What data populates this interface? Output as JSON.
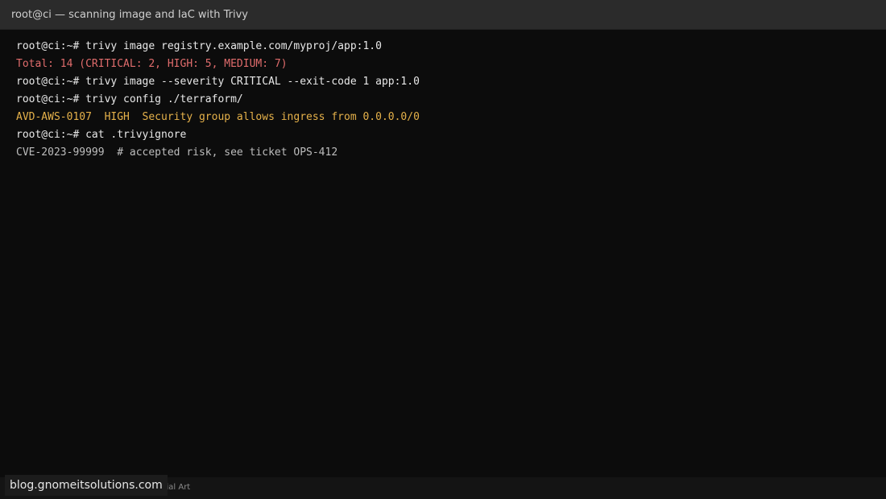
{
  "window": {
    "title": "root@ci — scanning image and IaC with Trivy"
  },
  "terminal": {
    "lines": [
      {
        "text": "root@ci:~# trivy image registry.example.com/myproj/app:1.0",
        "color": "#e8e8e8"
      },
      {
        "text": "Total: 14 (CRITICAL: 2, HIGH: 5, MEDIUM: 7)",
        "color": "#e06c6c"
      },
      {
        "text": "root@ci:~# trivy image --severity CRITICAL --exit-code 1 app:1.0",
        "color": "#e8e8e8"
      },
      {
        "text": "root@ci:~# trivy config ./terraform/",
        "color": "#e8e8e8"
      },
      {
        "text": "AVD-AWS-0107  HIGH  Security group allows ingress from 0.0.0.0/0",
        "color": "#e5b14a"
      },
      {
        "text": "root@ci:~# cat .trivyignore",
        "color": "#e8e8e8"
      },
      {
        "text": "CVE-2023-99999  # accepted risk, see ticket OPS-412",
        "color": "#bdbdbd"
      }
    ]
  },
  "statusbar": {
    "caption": "utorial Art"
  },
  "watermark": {
    "text": "blog.gnomeitsolutions.com"
  }
}
